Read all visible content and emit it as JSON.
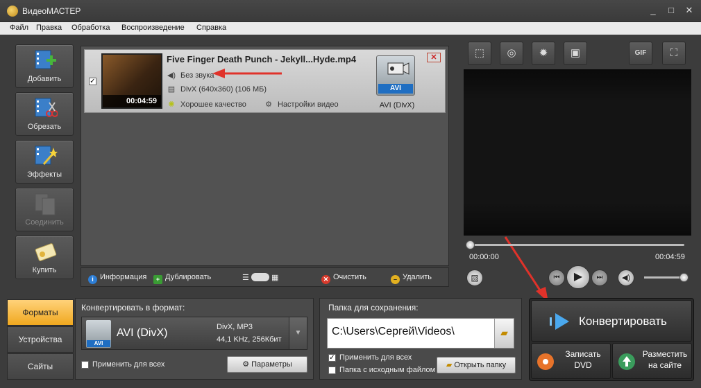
{
  "window": {
    "title": "ВидеоМАСТЕР",
    "minimize": "_",
    "maximize": "□",
    "close": "✕"
  },
  "menu": [
    "Файл",
    "Правка",
    "Обработка",
    "Воспроизведение",
    "Справка"
  ],
  "sidebar": [
    {
      "label": "Добавить",
      "icon": "film-add-icon"
    },
    {
      "label": "Обрезать",
      "icon": "film-cut-icon"
    },
    {
      "label": "Эффекты",
      "icon": "magic-wand-icon"
    },
    {
      "label": "Соединить",
      "icon": "film-join-icon",
      "disabled": true
    },
    {
      "label": "Купить",
      "icon": "buy-key-icon"
    }
  ],
  "file": {
    "checked": true,
    "title": "Five Finger Death Punch - Jekyll...Hyde.mp4",
    "duration": "00:04:59",
    "audio": "Без звука",
    "video": "DivX (640x360) (106 МБ)",
    "quality": "Хорошее качество",
    "video_settings": "Настройки видео",
    "format_tag": "AVI",
    "format_name": "AVI (DivX)"
  },
  "listbar": {
    "info": "Информация",
    "duplicate": "Дублировать",
    "clear": "Очистить",
    "delete": "Удалить"
  },
  "player": {
    "time_current": "00:00:00",
    "time_total": "00:04:59",
    "position": 0,
    "volume": 1.0,
    "tools": [
      "crop-icon",
      "rotate-icon",
      "brightness-icon",
      "frame-icon",
      "GIF",
      "fullscreen-icon"
    ]
  },
  "tabs": {
    "formats": "Форматы",
    "devices": "Устройства",
    "sites": "Сайты"
  },
  "format_panel": {
    "title": "Конвертировать в формат:",
    "selected": "AVI (DivX)",
    "tag": "AVI",
    "codecs": "DivX, MP3",
    "audio_params": "44,1 KHz, 256Кбит",
    "apply_all": "Применить для всех",
    "params_button": "Параметры"
  },
  "save_panel": {
    "title": "Папка для сохранения:",
    "path": "C:\\Users\\Сергей\\Videos\\",
    "apply_all": "Применить для всех",
    "source_folder": "Папка с исходным файлом",
    "open_folder": "Открыть папку"
  },
  "actions": {
    "convert": "Конвертировать",
    "burn_dvd_line1": "Записать",
    "burn_dvd_line2": "DVD",
    "publish_line1": "Разместить",
    "publish_line2": "на сайте"
  },
  "colors": {
    "accent_orange": "#f0a81f",
    "arrow_red": "#e0322a",
    "format_blue": "#1f6ec2"
  }
}
